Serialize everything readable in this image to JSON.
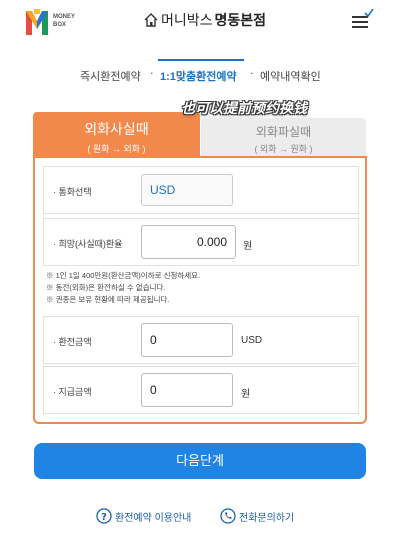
{
  "header": {
    "logo_text_line1": "MONEY",
    "logo_text_line2": "BOX",
    "brand": "머니박스",
    "branch": "명동본점"
  },
  "steps": [
    {
      "label": "즉시환전예약"
    },
    {
      "label": "1:1맞춤환전예약"
    },
    {
      "label": "예약내역확인"
    }
  ],
  "banner": "也可以提前预约换钱",
  "tabs": [
    {
      "label": "외화사실때",
      "sub": "( 원화 → 외화 )"
    },
    {
      "label": "외화파실때",
      "sub": "( 외화 → 원화 )"
    }
  ],
  "form": {
    "currency_label": "· 통화선택",
    "currency_value": "USD",
    "rate_label": "· 희망(사실때)환율",
    "rate_value": "0.000",
    "rate_unit": "원",
    "notes": [
      "※ 1인 1일 400만원(환산금액)이하로 신청하세요.",
      "※ 동전(외화)은 환전하실 수 없습니다.",
      "※ 권종은 보유 현황에 따라 제공됩니다."
    ],
    "exchange_label": "· 환전금액",
    "exchange_value": "0",
    "exchange_unit": "USD",
    "payment_label": "· 지급금액",
    "payment_value": "0",
    "payment_unit": "원"
  },
  "next_button": "다음단계",
  "links": [
    {
      "label": "환전예약 이용안내",
      "icon": "question-circle-icon"
    },
    {
      "label": "전화문의하기",
      "icon": "phone-icon"
    }
  ],
  "colors": {
    "accent": "#1f84e3",
    "orange": "#f1894c"
  }
}
